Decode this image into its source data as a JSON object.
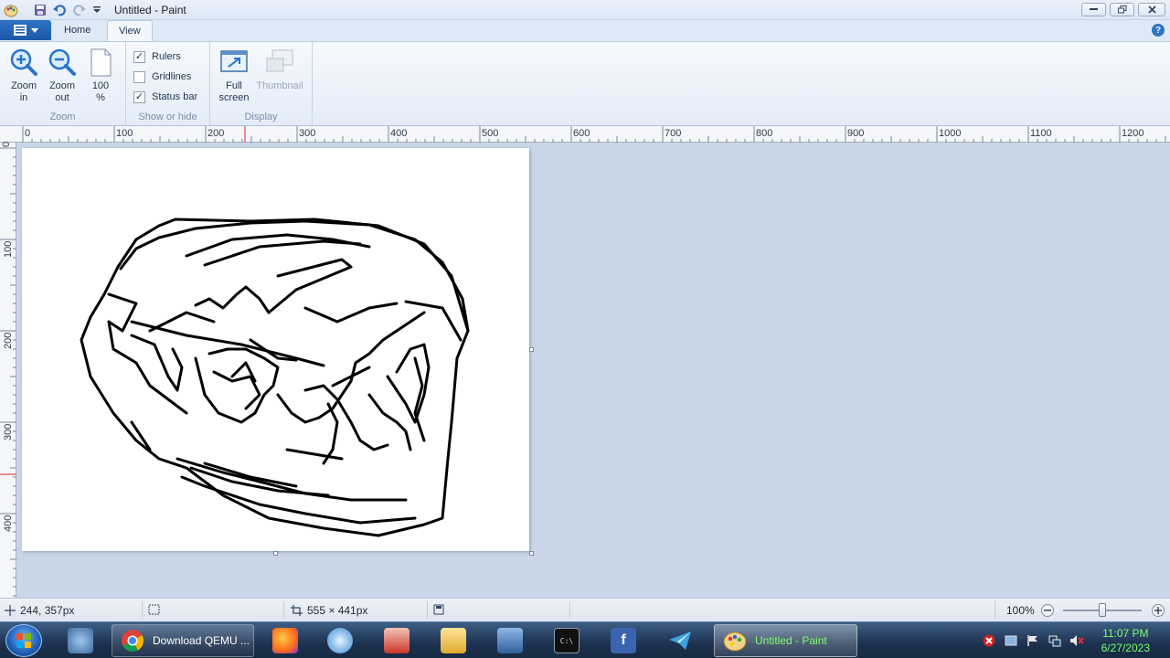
{
  "window": {
    "title": "Untitled - Paint"
  },
  "tabs": [
    {
      "label": "Home"
    },
    {
      "label": "View"
    }
  ],
  "ribbon": {
    "zoom_group": {
      "label": "Zoom",
      "zoom_in": "Zoom\nin",
      "zoom_out": "Zoom\nout",
      "hundred": "100\n%"
    },
    "show_group": {
      "label": "Show or hide",
      "rulers": "Rulers",
      "rulers_checked": true,
      "gridlines": "Gridlines",
      "gridlines_checked": false,
      "statusbar": "Status bar",
      "statusbar_checked": true
    },
    "display_group": {
      "label": "Display",
      "full_screen": "Full\nscreen",
      "thumbnail": "Thumbnail"
    }
  },
  "hruler_labels": [
    "0",
    "100",
    "200",
    "300",
    "400",
    "500",
    "600",
    "700",
    "800",
    "900",
    "1000",
    "1100",
    "1200"
  ],
  "vruler_labels": [
    "0",
    "100",
    "200",
    "300",
    "400"
  ],
  "status": {
    "cursor_pos": "244, 357px",
    "selection_size": "",
    "canvas_size": "555 × 441px",
    "zoom": "100%"
  },
  "taskbar": {
    "items": [
      {
        "label": "Download QEMU ...",
        "icon": "chrome-icon"
      },
      {
        "label": "Untitled - Paint",
        "icon": "paint-icon"
      }
    ],
    "clock_time": "11:07 PM",
    "clock_date": "6/27/2023"
  },
  "colors": {
    "accent": "#1c58a8",
    "workspace": "#c9d6e7",
    "clock": "#7cff6a"
  }
}
